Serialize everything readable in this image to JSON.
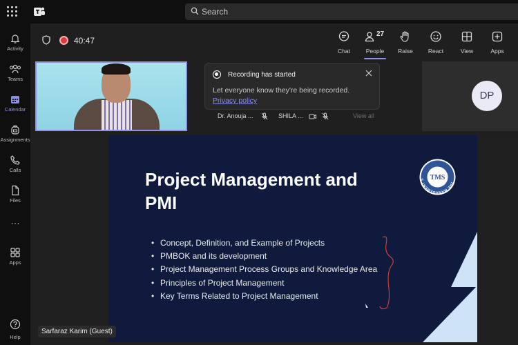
{
  "search": {
    "placeholder": "Search"
  },
  "rail": {
    "items": [
      {
        "label": "Activity"
      },
      {
        "label": "Teams"
      },
      {
        "label": "Calendar"
      },
      {
        "label": "Assignments"
      },
      {
        "label": "Calls"
      },
      {
        "label": "Files"
      },
      {
        "label": "Apps"
      }
    ],
    "more": "…",
    "help": "Help"
  },
  "meeting": {
    "timer": "40:47",
    "toolbar": {
      "chat": "Chat",
      "people": "People",
      "people_count": "27",
      "raise": "Raise",
      "react": "React",
      "view": "View",
      "apps": "Apps"
    }
  },
  "toast": {
    "title": "Recording has started",
    "message": "Let everyone know they're being recorded.",
    "link": "Privacy policy"
  },
  "participants": {
    "names": [
      "Dr. Anouja ...",
      "SHILA ..."
    ],
    "view_all": "View all",
    "dp_initials": "DP"
  },
  "slide": {
    "title": "Project Management and PMI",
    "bullets": [
      "Concept, Definition, and Example of Projects",
      "PMBOK and its development",
      "Project Management Process Groups and Knowledge Area",
      "Principles of Project Management",
      "Key Terms Related to Project Management"
    ],
    "logo_text": "THE MANAGEMENT STRATEGY",
    "logo_initials": "TMS",
    "colors": {
      "background": "#0f1a3d",
      "triangle": "#cfe3f7",
      "annotation": "#d23a3a"
    }
  },
  "presenter": {
    "name": "Sarfaraz Karim (Guest)"
  },
  "accent": "#8b8fe8"
}
